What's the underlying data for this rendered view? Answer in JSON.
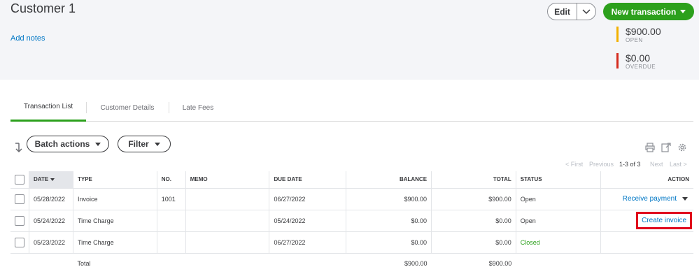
{
  "customer": {
    "name": "Customer 1",
    "add_notes_label": "Add notes"
  },
  "header_actions": {
    "edit_label": "Edit",
    "new_transaction_label": "New transaction"
  },
  "summary": {
    "open": {
      "amount": "$900.00",
      "label": "OPEN",
      "color": "#f2b100"
    },
    "overdue": {
      "amount": "$0.00",
      "label": "OVERDUE",
      "color": "#d52b1e"
    }
  },
  "tabs": [
    {
      "label": "Transaction List",
      "active": true
    },
    {
      "label": "Customer Details",
      "active": false
    },
    {
      "label": "Late Fees",
      "active": false
    }
  ],
  "toolbar": {
    "batch_actions_label": "Batch actions",
    "filter_label": "Filter",
    "icons": [
      "sort-icon",
      "print-icon",
      "export-icon",
      "settings-icon"
    ]
  },
  "pager": {
    "first": "< First",
    "previous": "Previous",
    "range": "1-3 of 3",
    "next": "Next",
    "last": "Last >"
  },
  "table": {
    "headers": {
      "date": "DATE",
      "type": "TYPE",
      "no": "NO.",
      "memo": "MEMO",
      "due_date": "DUE DATE",
      "balance": "BALANCE",
      "total": "TOTAL",
      "status": "STATUS",
      "action": "ACTION"
    },
    "rows": [
      {
        "date": "05/28/2022",
        "type": "Invoice",
        "no": "1001",
        "memo": "",
        "due_date": "06/27/2022",
        "balance": "$900.00",
        "total": "$900.00",
        "status": "Open",
        "action": "Receive payment"
      },
      {
        "date": "05/24/2022",
        "type": "Time Charge",
        "no": "",
        "memo": "",
        "due_date": "05/24/2022",
        "balance": "$0.00",
        "total": "$0.00",
        "status": "Open",
        "action": "Create invoice"
      },
      {
        "date": "05/23/2022",
        "type": "Time Charge",
        "no": "",
        "memo": "",
        "due_date": "06/27/2022",
        "balance": "$0.00",
        "total": "$0.00",
        "status": "Closed",
        "action": ""
      }
    ],
    "total_row": {
      "label": "Total",
      "balance": "$900.00",
      "total": "$900.00"
    }
  },
  "colors": {
    "brand_green": "#2ca01c",
    "link_blue": "#0077c5",
    "highlight_red": "#e0001b"
  }
}
